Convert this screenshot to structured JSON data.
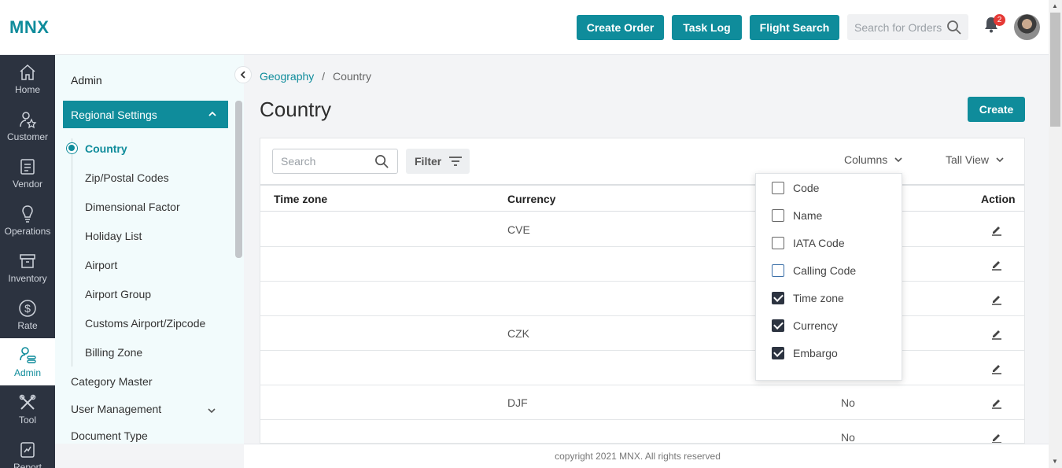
{
  "header": {
    "logo": "MNX",
    "create_order": "Create Order",
    "task_log": "Task Log",
    "flight_search": "Flight Search",
    "search_placeholder": "Search for Orders",
    "notification_count": "2"
  },
  "leftnav": [
    {
      "label": "Home",
      "icon": "home-icon"
    },
    {
      "label": "Customer",
      "icon": "customer-icon"
    },
    {
      "label": "Vendor",
      "icon": "vendor-icon"
    },
    {
      "label": "Operations",
      "icon": "operations-icon"
    },
    {
      "label": "Inventory",
      "icon": "inventory-icon"
    },
    {
      "label": "Rate",
      "icon": "rate-icon"
    },
    {
      "label": "Admin",
      "icon": "admin-icon",
      "active": true
    },
    {
      "label": "Tool",
      "icon": "tool-icon"
    },
    {
      "label": "Report",
      "icon": "report-icon"
    }
  ],
  "subnav": {
    "title": "Admin",
    "group": "Regional Settings",
    "items": [
      "Country",
      "Zip/Postal Codes",
      "Dimensional Factor",
      "Holiday List",
      "Airport",
      "Airport Group",
      "Customs Airport/Zipcode",
      "Billing Zone"
    ],
    "top_items": [
      "Category Master",
      "User Management",
      "Document Type"
    ]
  },
  "breadcrumb": {
    "parent": "Geography",
    "separator": "/",
    "current": "Country"
  },
  "page": {
    "title": "Country",
    "create_label": "Create"
  },
  "toolbar": {
    "search_placeholder": "Search",
    "filter_label": "Filter",
    "columns_label": "Columns",
    "view_label": "Tall View"
  },
  "table": {
    "headers": {
      "timezone": "Time zone",
      "currency": "Currency",
      "action": "Action"
    },
    "rows": [
      {
        "timezone": "",
        "currency": "CVE",
        "embargo": ""
      },
      {
        "timezone": "",
        "currency": "",
        "embargo": ""
      },
      {
        "timezone": "",
        "currency": "",
        "embargo": ""
      },
      {
        "timezone": "",
        "currency": "CZK",
        "embargo": ""
      },
      {
        "timezone": "",
        "currency": "",
        "embargo": ""
      },
      {
        "timezone": "",
        "currency": "DJF",
        "embargo": "No"
      },
      {
        "timezone": "",
        "currency": "",
        "embargo": "No"
      }
    ]
  },
  "columns_menu": [
    {
      "label": "Code",
      "checked": false
    },
    {
      "label": "Name",
      "checked": false
    },
    {
      "label": "IATA Code",
      "checked": false
    },
    {
      "label": "Calling Code",
      "checked": false
    },
    {
      "label": "Time zone",
      "checked": true
    },
    {
      "label": "Currency",
      "checked": true
    },
    {
      "label": "Embargo",
      "checked": true
    }
  ],
  "footer": {
    "copyright": "copyright 2021 MNX. All rights reserved"
  },
  "colors": {
    "accent": "#0f8c9b",
    "nav_dark": "#2c3340",
    "badge": "#e53935"
  }
}
